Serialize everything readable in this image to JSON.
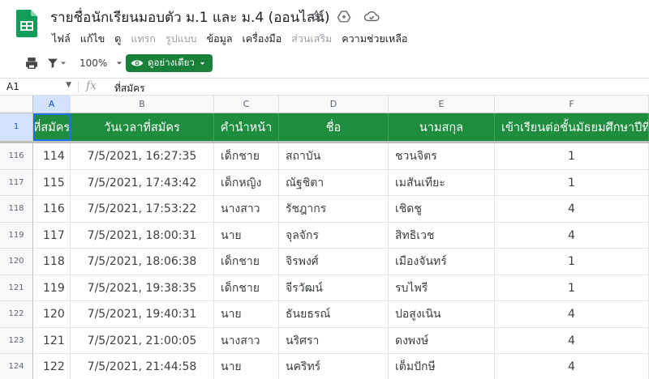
{
  "document": {
    "title": "รายชื่อนักเรียนมอบตัว ม.1 และ ม.4 (ออนไลน์)"
  },
  "menu": [
    {
      "label": "ไฟล์",
      "disabled": false
    },
    {
      "label": "แก้ไข",
      "disabled": false
    },
    {
      "label": "ดู",
      "disabled": false
    },
    {
      "label": "แทรก",
      "disabled": true
    },
    {
      "label": "รูปแบบ",
      "disabled": true
    },
    {
      "label": "ข้อมูล",
      "disabled": false
    },
    {
      "label": "เครื่องมือ",
      "disabled": false
    },
    {
      "label": "ส่วนเสริม",
      "disabled": true
    },
    {
      "label": "ความช่วยเหลือ",
      "disabled": false
    }
  ],
  "toolbar": {
    "zoom": "100%",
    "mode_label": "ดูอย่างเดียว"
  },
  "formula_bar": {
    "cell_ref": "A1",
    "fx_label": "fx",
    "content": "ที่สมัคร"
  },
  "columns": [
    "A",
    "B",
    "C",
    "D",
    "E",
    "F"
  ],
  "header_row_number": "1",
  "headers": [
    "ที่สมัคร",
    "วันเวลาที่สมัคร",
    "คำนำหน้า",
    "ชื่อ",
    "นามสกุล",
    "เข้าเรียนต่อชั้นมัธยมศึกษาปีที่"
  ],
  "rows": [
    {
      "num": "116",
      "cells": [
        "114",
        "7/5/2021, 16:27:35",
        "เด็กชาย",
        "สถาบัน",
        "ชวนจิตร",
        "1"
      ]
    },
    {
      "num": "117",
      "cells": [
        "115",
        "7/5/2021, 17:43:42",
        "เด็กหญิง",
        "ณัฐชิตา",
        "เมสันเทียะ",
        "1"
      ]
    },
    {
      "num": "118",
      "cells": [
        "116",
        "7/5/2021, 17:53:22",
        "นางสาว",
        "รัชฎากร",
        "เชิดชู",
        "4"
      ]
    },
    {
      "num": "119",
      "cells": [
        "117",
        "7/5/2021, 18:00:31",
        "นาย",
        "จุลจักร",
        "สิทธิเวช",
        "4"
      ]
    },
    {
      "num": "120",
      "cells": [
        "118",
        "7/5/2021, 18:06:38",
        "เด็กชาย",
        "จิรพงศ์",
        "เมืองจันทร์",
        "1"
      ]
    },
    {
      "num": "121",
      "cells": [
        "119",
        "7/5/2021, 19:38:35",
        "เด็กชาย",
        "จีรวัฒน์",
        "รบไพรี",
        "1"
      ]
    },
    {
      "num": "122",
      "cells": [
        "120",
        "7/5/2021, 19:40:31",
        "นาย",
        "ธันยธรณ์",
        "ปอสูงเนิน",
        "4"
      ]
    },
    {
      "num": "123",
      "cells": [
        "121",
        "7/5/2021, 21:00:05",
        "นางสาว",
        "นริศรา",
        "ดงพงษ์",
        "4"
      ]
    },
    {
      "num": "124",
      "cells": [
        "122",
        "7/5/2021, 21:44:58",
        "นาย",
        "นคริทร์",
        "เต็มปักษี",
        "4"
      ]
    }
  ],
  "colors": {
    "header_green": "#1e8e3e",
    "mode_button_green": "#188038",
    "selection_blue": "#1a73e8"
  }
}
